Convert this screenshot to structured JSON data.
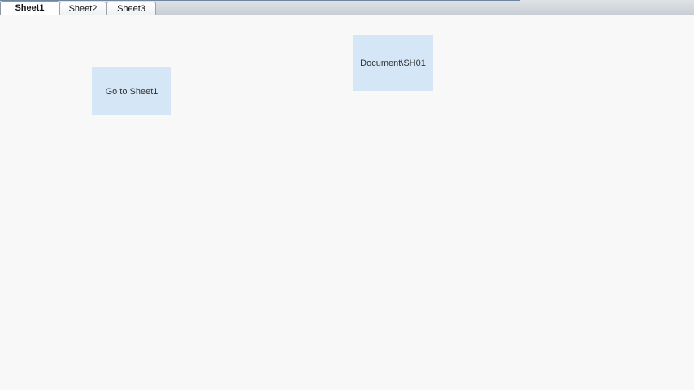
{
  "tabs": [
    {
      "label": "Sheet1",
      "active": true
    },
    {
      "label": "Sheet2",
      "active": false
    },
    {
      "label": "Sheet3",
      "active": false
    }
  ],
  "canvas": {
    "goto_button_label": "Go to Sheet1",
    "document_box_label": "Document\\SH01"
  },
  "colors": {
    "background": "#f8f8f8",
    "shape_fill": "#d5e6f6",
    "tab_strip": "#c8ced4"
  }
}
